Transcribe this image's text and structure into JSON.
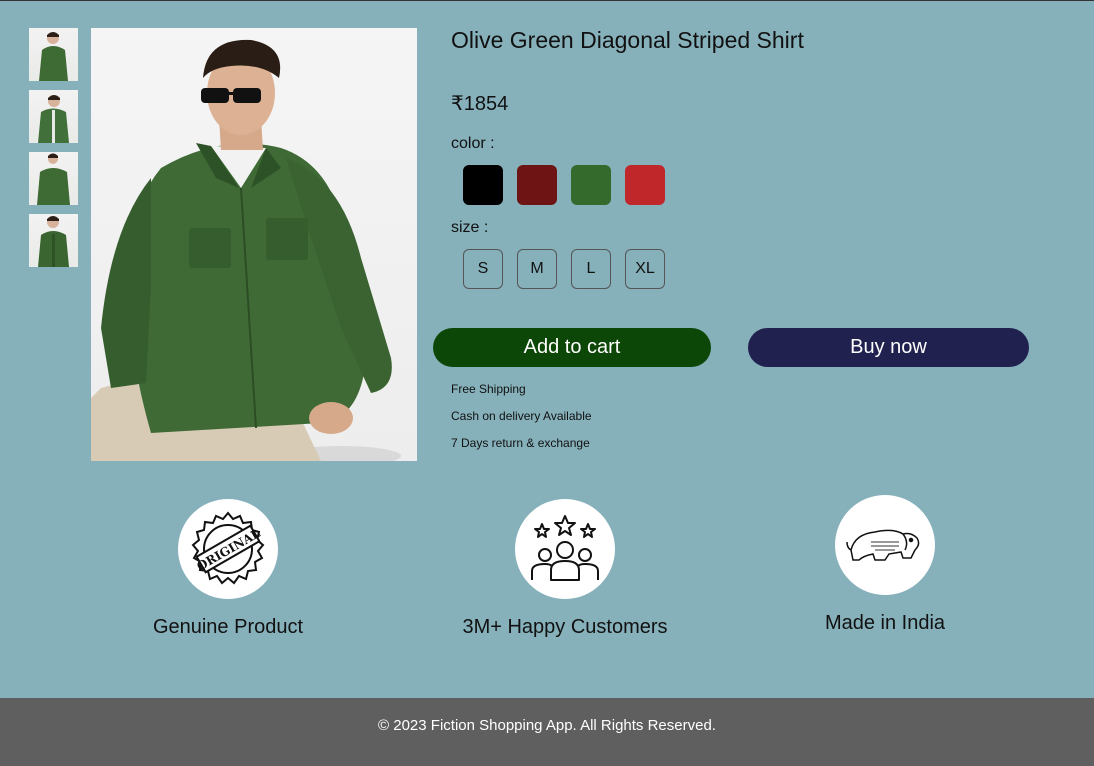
{
  "product": {
    "title": "Olive Green Diagonal Striped Shirt",
    "price": "₹1854",
    "color_label": "color :",
    "size_label": "size :",
    "colors": [
      "#000000",
      "#6e1414",
      "#346b2c",
      "#c0272b"
    ],
    "sizes": [
      "S",
      "M",
      "L",
      "XL"
    ]
  },
  "actions": {
    "add_to_cart": "Add to cart",
    "buy_now": "Buy now"
  },
  "perks": [
    "Free Shipping",
    "Cash on delivery Available",
    "7 Days return & exchange"
  ],
  "features": [
    {
      "label": "Genuine Product",
      "icon": "original-stamp-icon"
    },
    {
      "label": "3M+ Happy Customers",
      "icon": "happy-customers-icon"
    },
    {
      "label": "Made in India",
      "icon": "make-in-india-lion-icon"
    }
  ],
  "footer": {
    "text": "© 2023 Fiction Shopping App. All Rights Reserved."
  }
}
